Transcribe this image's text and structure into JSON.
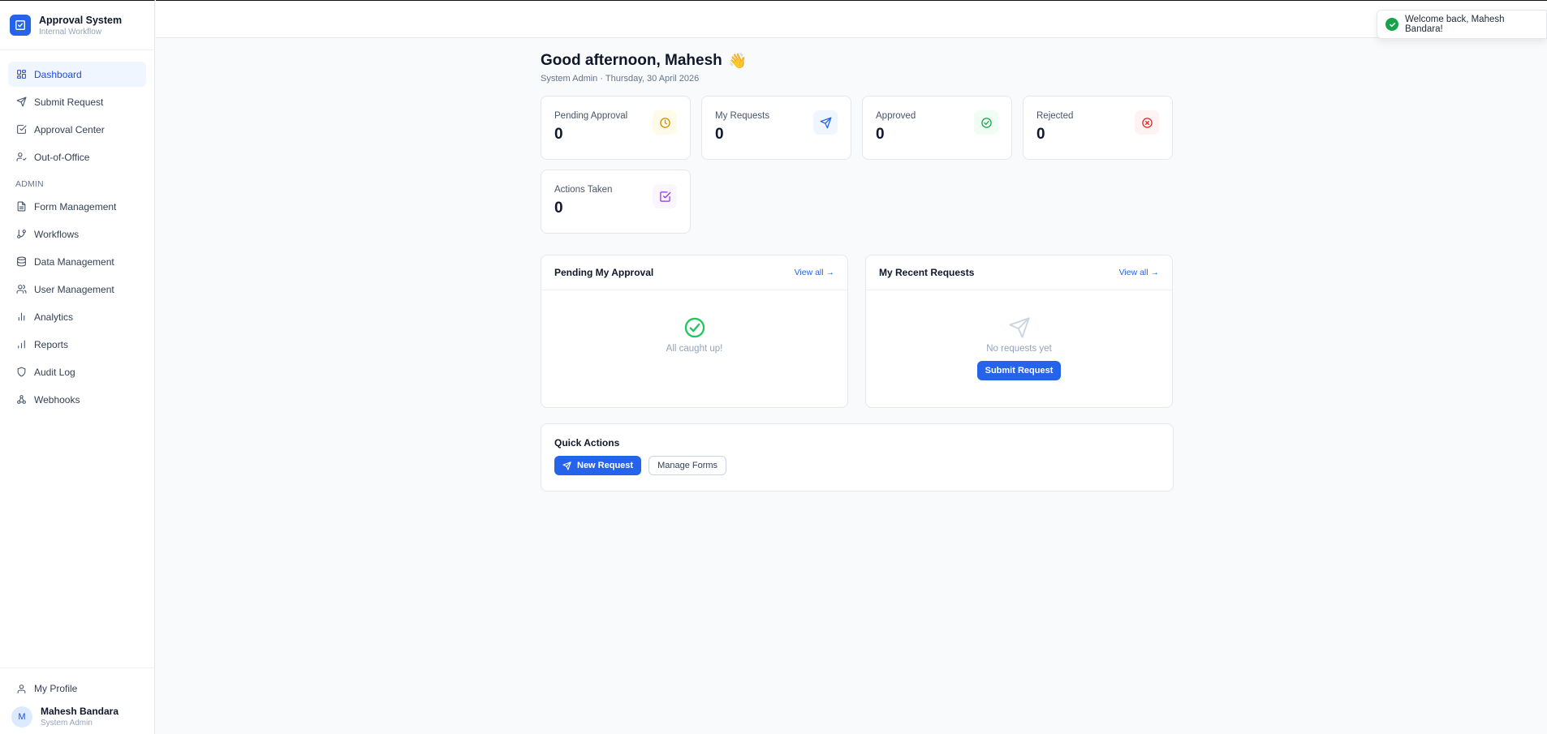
{
  "brand": {
    "title": "Approval System",
    "subtitle": "Internal Workflow"
  },
  "sidebar": {
    "items": [
      {
        "label": "Dashboard",
        "icon": "dashboard-icon"
      },
      {
        "label": "Submit Request",
        "icon": "send-icon"
      },
      {
        "label": "Approval Center",
        "icon": "check-square-icon"
      },
      {
        "label": "Out-of-Office",
        "icon": "user-check-icon"
      }
    ],
    "admin_label": "ADMIN",
    "admin_items": [
      {
        "label": "Form Management",
        "icon": "file-text-icon"
      },
      {
        "label": "Workflows",
        "icon": "git-branch-icon"
      },
      {
        "label": "Data Management",
        "icon": "database-icon"
      },
      {
        "label": "User Management",
        "icon": "users-icon"
      },
      {
        "label": "Analytics",
        "icon": "bar-chart-icon"
      },
      {
        "label": "Reports",
        "icon": "reports-chart-icon"
      },
      {
        "label": "Audit Log",
        "icon": "shield-icon"
      },
      {
        "label": "Webhooks",
        "icon": "webhook-icon"
      }
    ],
    "profile_label": "My Profile",
    "user": {
      "initial": "M",
      "name": "Mahesh Bandara",
      "role": "System Admin"
    }
  },
  "toast": {
    "message": "Welcome back, Mahesh Bandara!"
  },
  "header": {
    "greeting": "Good afternoon, Mahesh",
    "wave": "👋",
    "subline": "System Admin · Thursday, 30 April 2026"
  },
  "stats": [
    {
      "label": "Pending Approval",
      "value": "0",
      "icon": "clock-icon",
      "color": "#ca8a04",
      "bg": "#fefce8"
    },
    {
      "label": "My Requests",
      "value": "0",
      "icon": "send-icon",
      "color": "#2563eb",
      "bg": "#eff6ff"
    },
    {
      "label": "Approved",
      "value": "0",
      "icon": "check-circle-icon",
      "color": "#16a34a",
      "bg": "#f0fdf4"
    },
    {
      "label": "Rejected",
      "value": "0",
      "icon": "x-circle-icon",
      "color": "#dc2626",
      "bg": "#fef2f2"
    },
    {
      "label": "Actions Taken",
      "value": "0",
      "icon": "check-square-icon",
      "color": "#9333ea",
      "bg": "#faf5ff"
    }
  ],
  "pending_panel": {
    "title": "Pending My Approval",
    "view_all": "View all →",
    "empty": "All caught up!"
  },
  "requests_panel": {
    "title": "My Recent Requests",
    "view_all": "View all →",
    "empty": "No requests yet",
    "button": "Submit Request"
  },
  "quick_actions": {
    "title": "Quick Actions",
    "new_request": "New Request",
    "manage_forms": "Manage Forms"
  },
  "colors": {
    "accent": "#2563eb",
    "success": "#16a34a"
  }
}
